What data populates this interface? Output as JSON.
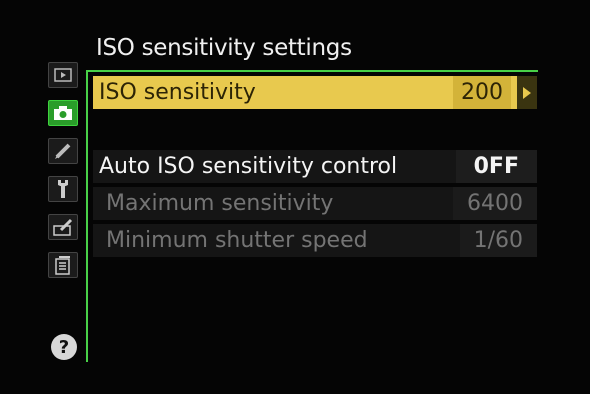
{
  "menu": {
    "title": "ISO sensitivity settings",
    "rows": [
      {
        "label": "ISO sensitivity",
        "value": "200"
      },
      {
        "label": "Auto ISO sensitivity control",
        "value": "0FF"
      },
      {
        "label": "Maximum sensitivity",
        "value": "6400"
      },
      {
        "label": "Minimum shutter speed",
        "value": "1/60"
      }
    ]
  },
  "tabs": [
    {
      "icon": "playback-icon"
    },
    {
      "icon": "camera-icon",
      "active": true
    },
    {
      "icon": "pencil-icon"
    },
    {
      "icon": "wrench-icon"
    },
    {
      "icon": "retouch-icon"
    },
    {
      "icon": "recent-settings-icon"
    }
  ],
  "help": {
    "label": "?"
  },
  "colors": {
    "highlight": "#e8c94e",
    "active_tab": "#2a9d2a",
    "frame": "#48d048",
    "disabled_text": "#747474"
  }
}
